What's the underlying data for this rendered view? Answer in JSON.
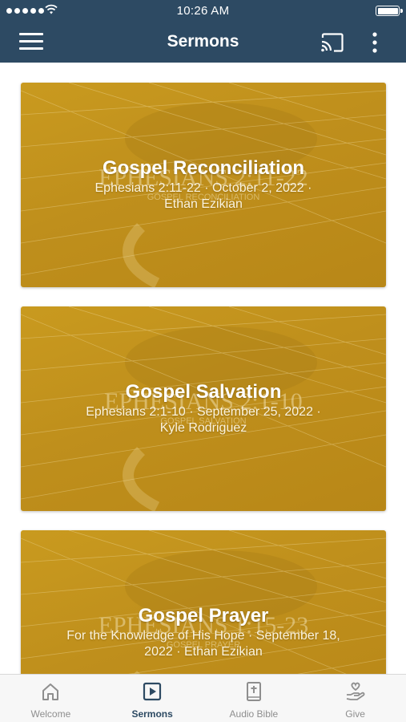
{
  "status_bar": {
    "time": "10:26 AM"
  },
  "nav": {
    "title": "Sermons"
  },
  "sermons": [
    {
      "title": "Gospel Reconciliation",
      "meta_line1": "Ephesians 2:11-22 · October 2, 2022 ·",
      "meta_line2": "Ethan Ezikian",
      "art_reference": "EPHESIANS 2:11-22",
      "art_subtitle": "GOSPEL RECONCILIATION"
    },
    {
      "title": "Gospel Salvation",
      "meta_line1": "Ephesians 2:1-10 · September 25, 2022 ·",
      "meta_line2": "Kyle Rodriguez",
      "art_reference": "EPHESIANS 2:1-10",
      "art_subtitle": "GOSPEL SALVATION"
    },
    {
      "title": "Gospel Prayer",
      "meta_line1": "For the Knowledge of His Hope · September 18,",
      "meta_line2": "2022 · Ethan Ezikian",
      "art_reference": "EPHESIANS 1:15-23",
      "art_subtitle": "GOSPEL PRAYER"
    }
  ],
  "tabs": [
    {
      "label": "Welcome",
      "icon": "home-icon",
      "active": false
    },
    {
      "label": "Sermons",
      "icon": "play-icon",
      "active": true
    },
    {
      "label": "Audio Bible",
      "icon": "bible-icon",
      "active": false
    },
    {
      "label": "Give",
      "icon": "give-icon",
      "active": false
    }
  ],
  "colors": {
    "nav_bg": "#2d4a63",
    "card_gold": "#c0901c",
    "tab_active": "#2d4a63",
    "tab_inactive": "#8e8e8e"
  }
}
